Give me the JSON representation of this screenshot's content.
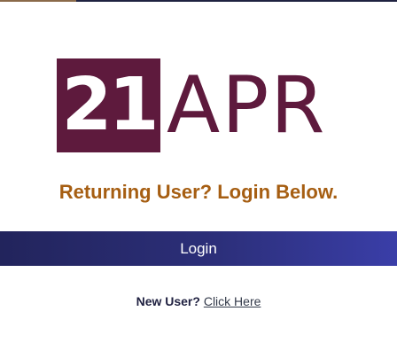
{
  "brand": {
    "logo_number": "21",
    "logo_word": "APR"
  },
  "headline": "Returning User? Login Below.",
  "login_button_label": "Login",
  "new_user": {
    "label": "New User?",
    "link_text": "Click Here"
  },
  "colors": {
    "brand_maroon": "#5e1a3d",
    "headline_orange": "#a65e12",
    "button_navy": "#2c2f7a"
  }
}
